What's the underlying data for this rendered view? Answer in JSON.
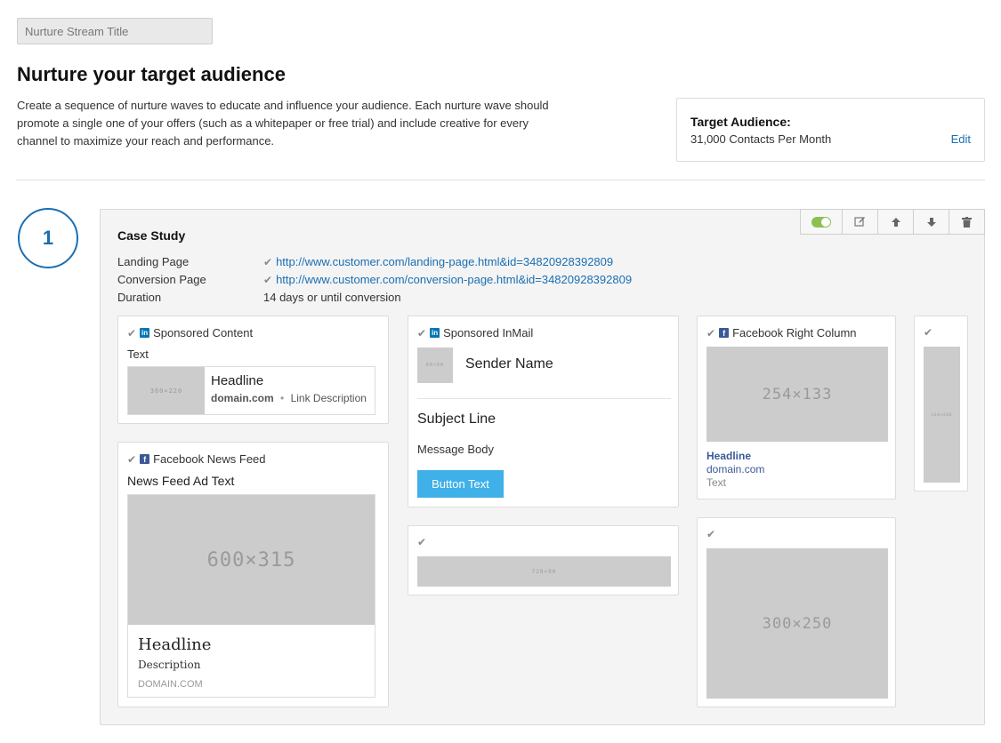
{
  "stream_title": {
    "placeholder": "Nurture Stream Title"
  },
  "page_title": "Nurture your target audience",
  "intro": "Create a sequence of nurture waves to educate and influence your audience. Each nurture wave should promote a single one of your offers (such as a whitepaper or free trial) and include creative for every channel to maximize your reach and performance.",
  "audience": {
    "title": "Target Audience:",
    "value": "31,000 Contacts Per Month",
    "edit": "Edit"
  },
  "wave": {
    "number": "1",
    "title": "Case Study",
    "landing_label": "Landing Page",
    "landing_url": "http://www.customer.com/landing-page.html&id=34820928392809",
    "conversion_label": "Conversion Page",
    "conversion_url": "http://www.customer.com/conversion-page.html&id=34820928392809",
    "duration_label": "Duration",
    "duration_value": "14 days or until conversion",
    "toolbar_icons": [
      "toggle-on",
      "edit-icon",
      "arrow-up-icon",
      "arrow-down-icon",
      "trash-icon"
    ]
  },
  "sponsored_content": {
    "label": "Sponsored Content",
    "text": "Text",
    "image": "360×220",
    "headline": "Headline",
    "domain": "domain.com",
    "link_desc": "Link Description"
  },
  "facebook_news": {
    "label": "Facebook News Feed",
    "ad_text": "News Feed Ad Text",
    "image": "600×315",
    "headline": "Headline",
    "description": "Description",
    "domain": "DOMAIN.COM"
  },
  "inmail": {
    "label": "Sponsored InMail",
    "avatar": "60×60",
    "sender": "Sender Name",
    "subject": "Subject Line",
    "body": "Message Body",
    "button": "Button Text"
  },
  "leaderboard": {
    "image": "728×90"
  },
  "facebook_right": {
    "label": "Facebook Right Column",
    "image": "254×133",
    "headline": "Headline",
    "domain": "domain.com",
    "text": "Text"
  },
  "medium_rect": {
    "image": "300×250"
  },
  "skyscraper": {
    "image": "160×600"
  },
  "colors": {
    "accent": "#1a6fb3",
    "button": "#3fb0e8",
    "toggle": "#8cc152",
    "placeholder": "#cccccc"
  }
}
